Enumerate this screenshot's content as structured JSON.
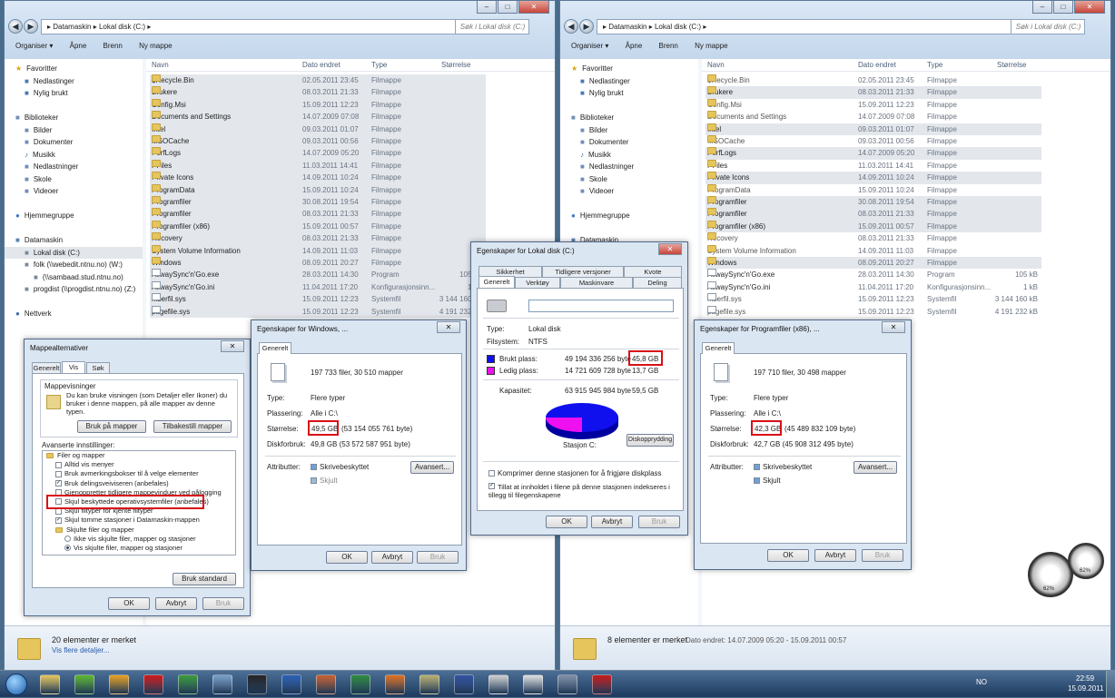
{
  "left_explorer": {
    "nav": {
      "back": "◀",
      "fwd": "▶"
    },
    "path": [
      "Datamaskin",
      "Lokal disk (C:)"
    ],
    "search_placeholder": "Søk i Lokal disk (C:)",
    "toolbar": [
      "Organiser ▾",
      "Åpne",
      "Brenn",
      "Ny mappe"
    ],
    "status_main": "20 elementer er merket",
    "status_sub": "Vis flere detaljer..."
  },
  "right_explorer": {
    "path": [
      "Datamaskin",
      "Lokal disk (C:)"
    ],
    "search_placeholder": "Søk i Lokal disk (C:)",
    "toolbar": [
      "Organiser ▾",
      "Åpne",
      "Brenn",
      "Ny mappe"
    ],
    "status_main": "8 elementer er merket",
    "status_dates": "Dato endret: 14.07.2009 05:20 - 15.09.2011 00:57"
  },
  "navpane": [
    {
      "t": "Favoritter",
      "ic": "★",
      "c": "#d9a41c",
      "ind": 0
    },
    {
      "t": "Nedlastinger",
      "ic": "■",
      "c": "#4a78b5",
      "ind": 1
    },
    {
      "t": "Nylig brukt",
      "ic": "■",
      "c": "#4a78b5",
      "ind": 1
    },
    {
      "t": "",
      "ic": "",
      "c": "",
      "ind": 0
    },
    {
      "t": "Biblioteker",
      "ic": "■",
      "c": "#6e8fb7",
      "ind": 0
    },
    {
      "t": "Bilder",
      "ic": "■",
      "c": "#6e8fb7",
      "ind": 1
    },
    {
      "t": "Dokumenter",
      "ic": "■",
      "c": "#6e8fb7",
      "ind": 1
    },
    {
      "t": "Musikk",
      "ic": "♪",
      "c": "#3b6ea5",
      "ind": 1
    },
    {
      "t": "Nedlastninger",
      "ic": "■",
      "c": "#6e8fb7",
      "ind": 1
    },
    {
      "t": "Skole",
      "ic": "■",
      "c": "#6e8fb7",
      "ind": 1
    },
    {
      "t": "Videoer",
      "ic": "■",
      "c": "#6e8fb7",
      "ind": 1
    },
    {
      "t": "",
      "ic": "",
      "c": "",
      "ind": 0
    },
    {
      "t": "Hjemmegruppe",
      "ic": "●",
      "c": "#3b78c2",
      "ind": 0
    },
    {
      "t": "",
      "ic": "",
      "c": "",
      "ind": 0
    },
    {
      "t": "Datamaskin",
      "ic": "■",
      "c": "#5b83b3",
      "ind": 0
    },
    {
      "t": "Lokal disk (C:)",
      "ic": "■",
      "c": "#7a8a9a",
      "ind": 1
    },
    {
      "t": "folk (\\\\webedit.ntnu.no) (W:)",
      "ic": "■",
      "c": "#7a8a9a",
      "ind": 1
    },
    {
      "t": "(\\\\sambaad.stud.ntnu.no)",
      "ic": "■",
      "c": "#7a8a9a",
      "ind": 2
    },
    {
      "t": "progdist (\\\\progdist.ntnu.no) (Z:)",
      "ic": "■",
      "c": "#7a8a9a",
      "ind": 1
    },
    {
      "t": "",
      "ic": "",
      "c": "",
      "ind": 0
    },
    {
      "t": "Nettverk",
      "ic": "●",
      "c": "#3b6ea5",
      "ind": 0
    }
  ],
  "navpane_right": [
    {
      "t": "Favoritter",
      "ic": "★",
      "c": "#d9a41c",
      "ind": 0
    },
    {
      "t": "Nedlastinger",
      "ic": "■",
      "c": "#4a78b5",
      "ind": 1
    },
    {
      "t": "Nylig brukt",
      "ic": "■",
      "c": "#4a78b5",
      "ind": 1
    },
    {
      "t": "",
      "ic": "",
      "c": "",
      "ind": 0
    },
    {
      "t": "Biblioteker",
      "ic": "■",
      "c": "#6e8fb7",
      "ind": 0
    },
    {
      "t": "Bilder",
      "ic": "■",
      "c": "#6e8fb7",
      "ind": 1
    },
    {
      "t": "Dokumenter",
      "ic": "■",
      "c": "#6e8fb7",
      "ind": 1
    },
    {
      "t": "Musikk",
      "ic": "♪",
      "c": "#3b6ea5",
      "ind": 1
    },
    {
      "t": "Nedlastninger",
      "ic": "■",
      "c": "#6e8fb7",
      "ind": 1
    },
    {
      "t": "Skole",
      "ic": "■",
      "c": "#6e8fb7",
      "ind": 1
    },
    {
      "t": "Videoer",
      "ic": "■",
      "c": "#6e8fb7",
      "ind": 1
    },
    {
      "t": "",
      "ic": "",
      "c": "",
      "ind": 0
    },
    {
      "t": "Hjemmegruppe",
      "ic": "●",
      "c": "#3b78c2",
      "ind": 0
    },
    {
      "t": "",
      "ic": "",
      "c": "",
      "ind": 0
    },
    {
      "t": "Datamaskin",
      "ic": "■",
      "c": "#5b83b3",
      "ind": 0
    }
  ],
  "columns": [
    "Navn",
    "Dato endret",
    "Type",
    "Størrelse"
  ],
  "files": [
    {
      "name": "$Recycle.Bin",
      "date": "02.05.2011 23:45",
      "type": "Filmappe",
      "size": "",
      "folder": true,
      "gray": true
    },
    {
      "name": "Brukere",
      "date": "08.03.2011 21:33",
      "type": "Filmappe",
      "size": "",
      "folder": true,
      "gray": false
    },
    {
      "name": "Config.Msi",
      "date": "15.09.2011 12:23",
      "type": "Filmappe",
      "size": "",
      "folder": true,
      "gray": true
    },
    {
      "name": "Documents and Settings",
      "date": "14.07.2009 07:08",
      "type": "Filmappe",
      "size": "",
      "folder": true,
      "gray": true
    },
    {
      "name": "Intel",
      "date": "09.03.2011 01:07",
      "type": "Filmappe",
      "size": "",
      "folder": true,
      "gray": false
    },
    {
      "name": "MSOCache",
      "date": "09.03.2011 00:56",
      "type": "Filmappe",
      "size": "",
      "folder": true,
      "gray": true
    },
    {
      "name": "PerfLogs",
      "date": "14.07.2009 05:20",
      "type": "Filmappe",
      "size": "",
      "folder": true,
      "gray": false
    },
    {
      "name": "PFiles",
      "date": "11.03.2011 14:41",
      "type": "Filmappe",
      "size": "",
      "folder": true,
      "gray": false
    },
    {
      "name": "Private Icons",
      "date": "14.09.2011 10:24",
      "type": "Filmappe",
      "size": "",
      "folder": true,
      "gray": false
    },
    {
      "name": "ProgramData",
      "date": "15.09.2011 10:24",
      "type": "Filmappe",
      "size": "",
      "folder": true,
      "gray": true
    },
    {
      "name": "Programfiler",
      "date": "30.08.2011 19:54",
      "type": "Filmappe",
      "size": "",
      "folder": true,
      "gray": false
    },
    {
      "name": "Programfiler",
      "date": "08.03.2011 21:33",
      "type": "Filmappe",
      "size": "",
      "folder": true,
      "gray": false
    },
    {
      "name": "Programfiler (x86)",
      "date": "15.09.2011 00:57",
      "type": "Filmappe",
      "size": "",
      "folder": true,
      "gray": false
    },
    {
      "name": "Recovery",
      "date": "08.03.2011 21:33",
      "type": "Filmappe",
      "size": "",
      "folder": true,
      "gray": true
    },
    {
      "name": "System Volume Information",
      "date": "14.09.2011 11:03",
      "type": "Filmappe",
      "size": "",
      "folder": true,
      "gray": true
    },
    {
      "name": "Windows",
      "date": "08.09.2011 20:27",
      "type": "Filmappe",
      "size": "",
      "folder": true,
      "gray": false
    },
    {
      "name": "AllwaySync'n'Go.exe",
      "date": "28.03.2011 14:30",
      "type": "Program",
      "size": "105 kB",
      "folder": false,
      "gray": false
    },
    {
      "name": "AllwaySync'n'Go.ini",
      "date": "11.04.2011 17:20",
      "type": "Konfigurasjonsinn...",
      "size": "1 kB",
      "folder": false,
      "gray": false
    },
    {
      "name": "hiberfil.sys",
      "date": "15.09.2011 12:23",
      "type": "Systemfil",
      "size": "3 144 160 kB",
      "folder": false,
      "gray": true
    },
    {
      "name": "pagefile.sys",
      "date": "15.09.2011 12:23",
      "type": "Systemfil",
      "size": "4 191 232 kB",
      "folder": false,
      "gray": true
    }
  ],
  "right_selected": [
    1,
    4,
    6,
    8,
    10,
    11,
    12,
    15
  ],
  "folder_options": {
    "title": "Mappealternativer",
    "tabs": [
      "Generelt",
      "Vis",
      "Søk"
    ],
    "group_title": "Mappevisninger",
    "group_text": "Du kan bruke visningen (som Detaljer eller Ikoner) du bruker i denne mappen, på alle mapper av denne typen.",
    "btn_apply": "Bruk på mapper",
    "btn_reset": "Tilbakestill mapper",
    "adv_title": "Avanserte innstillinger:",
    "items": [
      {
        "t": "Filer og mapper",
        "k": "folder",
        "ind": 0
      },
      {
        "t": "Alltid vis menyer",
        "k": "unchecked",
        "ind": 1
      },
      {
        "t": "Bruk avmerkingsbokser til å velge elementer",
        "k": "unchecked",
        "ind": 1
      },
      {
        "t": "Bruk delingsveiviseren (anbefales)",
        "k": "checked",
        "ind": 1
      },
      {
        "t": "Gjenoppretter tidligere mappevinduer ved pålogging",
        "k": "unchecked",
        "ind": 1
      },
      {
        "t": "Skjul beskyttede operativsystemfiler (anbefales)",
        "k": "unchecked",
        "ind": 1
      },
      {
        "t": "Skjul filtyper for kjente filtyper",
        "k": "unchecked",
        "ind": 1
      },
      {
        "t": "Skjul tomme stasjoner i Datamaskin-mappen",
        "k": "checked",
        "ind": 1
      },
      {
        "t": "Skjulte filer og mapper",
        "k": "folder",
        "ind": 1
      },
      {
        "t": "Ikke vis skjulte filer, mapper og stasjoner",
        "k": "radio",
        "ind": 2
      },
      {
        "t": "Vis skjulte filer, mapper og stasjoner",
        "k": "radio-on",
        "ind": 2
      }
    ],
    "btn_default": "Bruk standard",
    "ok": "OK",
    "cancel": "Avbryt",
    "apply": "Bruk"
  },
  "props_windows": {
    "title": "Egenskaper for Windows, ...",
    "tab": "Generelt",
    "count": "197 733 filer, 30 510 mapper",
    "type_label": "Type:",
    "type_val": "Flere typer",
    "loc_label": "Plassering:",
    "loc_val": "Alle i C:\\",
    "size_label": "Størrelse:",
    "size_val": "49,5 GB",
    "size_bytes": "(53 154 055 761 byte)",
    "disk_label": "Diskforbruk:",
    "disk_val": "49,8 GB (53 572 587 951 byte)",
    "attr_label": "Attributter:",
    "ro": "Skrivebeskyttet",
    "hidden": "Skjult",
    "adv": "Avansert...",
    "ok": "OK",
    "cancel": "Avbryt",
    "apply": "Bruk"
  },
  "props_c": {
    "title": "Egenskaper for Lokal disk (C:)",
    "tabs_row1": [
      "Sikkerhet",
      "Tidligere versjoner",
      "Kvote"
    ],
    "tabs_row2": [
      "Generelt",
      "Verktøy",
      "Maskinvare",
      "Deling"
    ],
    "type_label": "Type:",
    "type_val": "Lokal disk",
    "fs_label": "Filsystem:",
    "fs_val": "NTFS",
    "used_label": "Brukt plass:",
    "used_bytes": "49 194 336 256 byte",
    "used_gb": "45,8 GB",
    "free_label": "Ledig plass:",
    "free_bytes": "14 721 609 728 byte",
    "free_gb": "13,7 GB",
    "cap_label": "Kapasitet:",
    "cap_bytes": "63 915 945 984 byte",
    "cap_gb": "59,5 GB",
    "drive": "Stasjon C:",
    "cleanup": "Diskopprydding",
    "compress": "Komprimer denne stasjonen for å frigjøre diskplass",
    "index": "Tillat at innholdet i filene på denne stasjonen indekseres i tillegg til filegenskapene",
    "ok": "OK",
    "cancel": "Avbryt",
    "apply": "Bruk",
    "used_color": "#1010ee",
    "free_color": "#ee10ee"
  },
  "props_x86": {
    "title": "Egenskaper for Programfiler (x86), ...",
    "tab": "Generelt",
    "count": "197 710 filer, 30 498 mapper",
    "type_label": "Type:",
    "type_val": "Flere typer",
    "loc_label": "Plassering:",
    "loc_val": "Alle i C:\\",
    "size_label": "Størrelse:",
    "size_val": "42,3 GB",
    "size_bytes": "(45 489 832 109 byte)",
    "disk_label": "Diskforbruk:",
    "disk_val": "42,7 GB (45 908 312 495 byte)",
    "attr_label": "Attributter:",
    "ro": "Skrivebeskyttet",
    "hidden": "Skjult",
    "adv": "Avansert...",
    "ok": "OK",
    "cancel": "Avbryt",
    "apply": "Bruk"
  },
  "gadget": {
    "cpu": "62%",
    "mem": "62%"
  },
  "taskbar": {
    "lang": "NO",
    "time": "22:59",
    "date": "15.09.2011",
    "icons": [
      {
        "n": "folder-icon",
        "c": "#e6c65c"
      },
      {
        "n": "spotify-icon",
        "c": "#5cb82f"
      },
      {
        "n": "outlook-icon",
        "c": "#e8a020"
      },
      {
        "n": "opera-icon",
        "c": "#d01818"
      },
      {
        "n": "chrome-icon",
        "c": "#3a9a3a"
      },
      {
        "n": "paint-icon",
        "c": "#7aa0c8"
      },
      {
        "n": "nx2-icon",
        "c": "#222222"
      },
      {
        "n": "word-icon",
        "c": "#2b5fb4"
      },
      {
        "n": "media-icon",
        "c": "#c86030"
      },
      {
        "n": "excel-icon",
        "c": "#2e8a3e"
      },
      {
        "n": "matlab-icon",
        "c": "#e07020"
      },
      {
        "n": "explorer-icon",
        "c": "#b8b070"
      },
      {
        "n": "grid-icon",
        "c": "#3050a0"
      },
      {
        "n": "tool-icon",
        "c": "#d0d0d0"
      },
      {
        "n": "calc-icon",
        "c": "#e0e0e0"
      },
      {
        "n": "display-icon",
        "c": "#8090a8"
      },
      {
        "n": "pdf-icon",
        "c": "#c81818"
      }
    ]
  }
}
